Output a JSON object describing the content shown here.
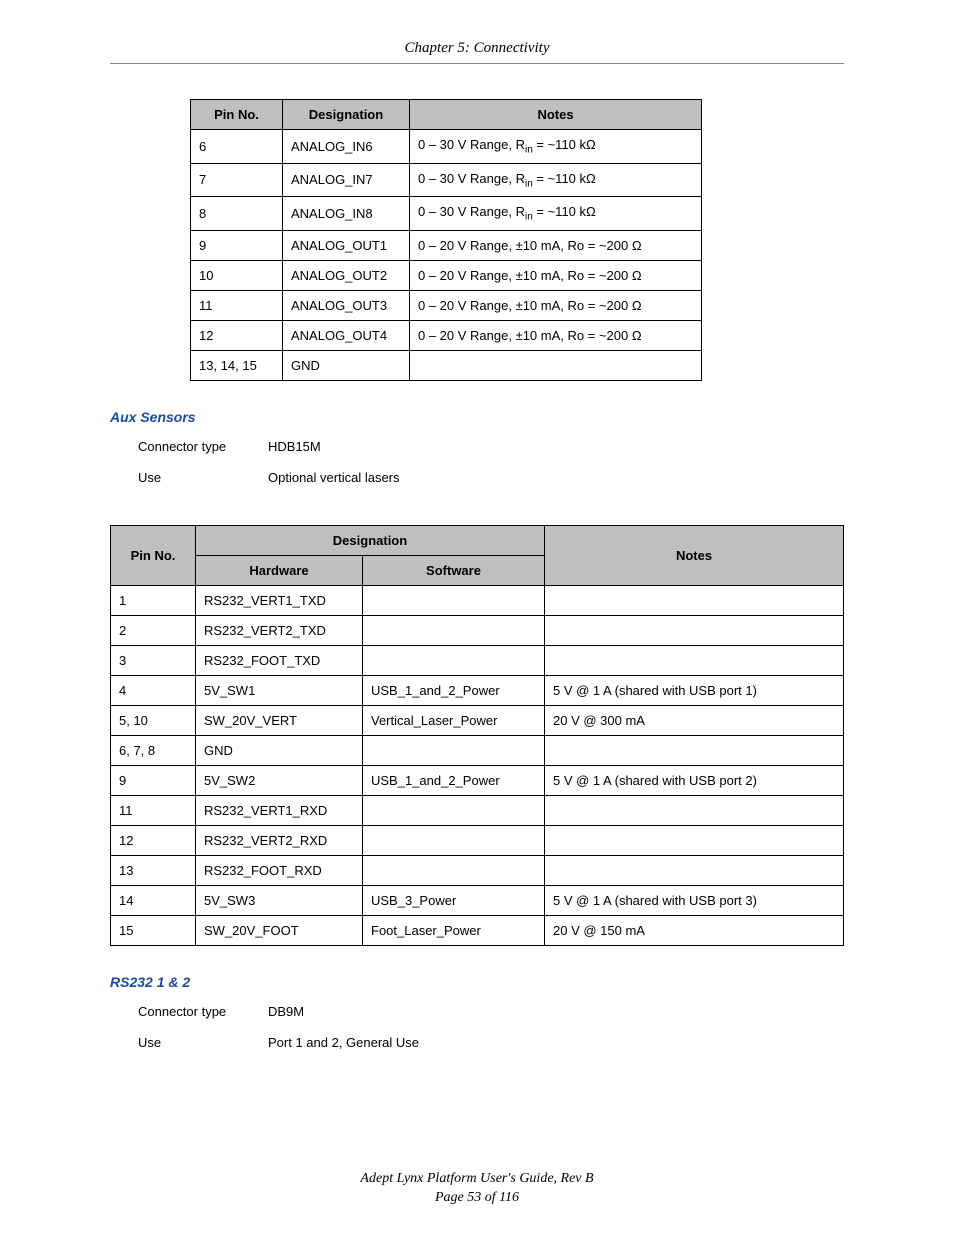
{
  "chapter_header": "Chapter 5: Connectivity",
  "table1": {
    "headers": {
      "pin": "Pin No.",
      "desig": "Designation",
      "notes": "Notes"
    },
    "rows": [
      {
        "pin": "6",
        "desig": "ANALOG_IN6",
        "notes_pre": "0 – 30 V Range, R",
        "notes_sub": "in",
        "notes_post": " = ~110 kΩ"
      },
      {
        "pin": "7",
        "desig": "ANALOG_IN7",
        "notes_pre": "0 – 30 V Range, R",
        "notes_sub": "in",
        "notes_post": " = ~110 kΩ"
      },
      {
        "pin": "8",
        "desig": "ANALOG_IN8",
        "notes_pre": "0 – 30 V Range, R",
        "notes_sub": "in",
        "notes_post": " = ~110 kΩ"
      },
      {
        "pin": "9",
        "desig": "ANALOG_OUT1",
        "notes_plain": "0 – 20 V Range, ±10 mA, Ro = ~200 Ω"
      },
      {
        "pin": "10",
        "desig": "ANALOG_OUT2",
        "notes_plain": "0 – 20 V Range, ±10 mA, Ro = ~200 Ω"
      },
      {
        "pin": "11",
        "desig": "ANALOG_OUT3",
        "notes_plain": "0 – 20 V Range, ±10 mA, Ro = ~200 Ω"
      },
      {
        "pin": "12",
        "desig": "ANALOG_OUT4",
        "notes_plain": "0 – 20 V Range, ±10 mA, Ro = ~200 Ω"
      },
      {
        "pin": "13, 14, 15",
        "desig": "GND",
        "notes_plain": ""
      }
    ]
  },
  "aux_sensors": {
    "title": "Aux Sensors",
    "connector_label": "Connector type",
    "connector_value": "HDB15M",
    "use_label": "Use",
    "use_value": "Optional vertical lasers"
  },
  "table2": {
    "headers": {
      "desig_group": "Designation",
      "pin": "Pin No.",
      "hw": "Hardware",
      "sw": "Software",
      "notes": "Notes"
    },
    "rows": [
      {
        "pin": "1",
        "hw": "RS232_VERT1_TXD",
        "sw": "",
        "notes": ""
      },
      {
        "pin": "2",
        "hw": "RS232_VERT2_TXD",
        "sw": "",
        "notes": ""
      },
      {
        "pin": "3",
        "hw": "RS232_FOOT_TXD",
        "sw": "",
        "notes": ""
      },
      {
        "pin": "4",
        "hw": "5V_SW1",
        "sw": "USB_1_and_2_Power",
        "notes": "5 V @ 1 A (shared with USB port 1)"
      },
      {
        "pin": "5, 10",
        "hw": "SW_20V_VERT",
        "sw": "Vertical_Laser_Power",
        "notes": "20 V @ 300 mA"
      },
      {
        "pin": "6, 7, 8",
        "hw": "GND",
        "sw": "",
        "notes": ""
      },
      {
        "pin": "9",
        "hw": "5V_SW2",
        "sw": "USB_1_and_2_Power",
        "notes": "5 V @ 1 A (shared with USB port 2)"
      },
      {
        "pin": "11",
        "hw": "RS232_VERT1_RXD",
        "sw": "",
        "notes": ""
      },
      {
        "pin": "12",
        "hw": "RS232_VERT2_RXD",
        "sw": "",
        "notes": ""
      },
      {
        "pin": "13",
        "hw": "RS232_FOOT_RXD",
        "sw": "",
        "notes": ""
      },
      {
        "pin": "14",
        "hw": "5V_SW3",
        "sw": "USB_3_Power",
        "notes": "5 V @ 1 A (shared with USB port 3)"
      },
      {
        "pin": "15",
        "hw": "SW_20V_FOOT",
        "sw": "Foot_Laser_Power",
        "notes": "20 V @ 150 mA"
      }
    ]
  },
  "rs232": {
    "title": "RS232 1 & 2",
    "connector_label": "Connector type",
    "connector_value": "DB9M",
    "use_label": "Use",
    "use_value": "Port 1 and 2, General Use"
  },
  "footer": {
    "line1": "Adept Lynx Platform User's Guide, Rev B",
    "line2": "Page 53 of 116"
  }
}
